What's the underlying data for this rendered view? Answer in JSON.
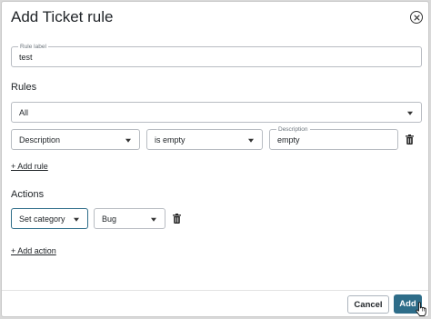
{
  "dialog": {
    "title": "Add Ticket rule"
  },
  "rule_label": {
    "label": "Rule label",
    "value": "test"
  },
  "rules": {
    "heading": "Rules",
    "match_select": "All",
    "condition": {
      "field": "Description",
      "operator": "is empty",
      "value_label": "Description",
      "value": "empty"
    },
    "add_link": "+ Add rule"
  },
  "actions": {
    "heading": "Actions",
    "action": {
      "type": "Set category",
      "value": "Bug"
    },
    "add_link": "+ Add action"
  },
  "footer": {
    "cancel_label": "Cancel",
    "add_label": "Add"
  },
  "colors": {
    "primary": "#2e6d89",
    "focus_border": "#2e6d89"
  },
  "icons": [
    "close-circle-icon",
    "chevron-down-icon",
    "trash-icon",
    "pointer-cursor-icon"
  ]
}
